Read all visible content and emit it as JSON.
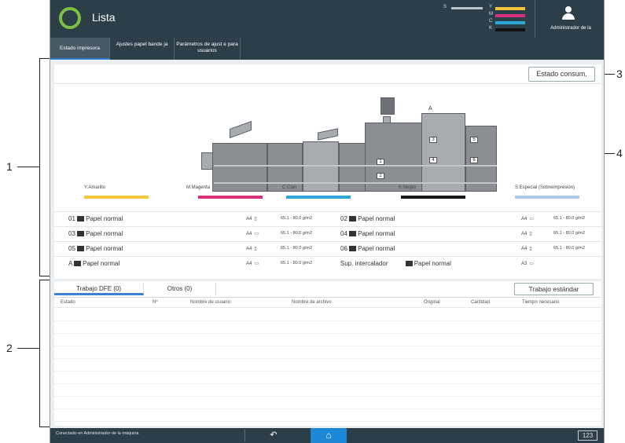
{
  "header": {
    "title": "Lista",
    "toner_labels": [
      "Y",
      "M",
      "C",
      "K"
    ],
    "toner_s_label": "S",
    "user_name": "Administrador de la",
    "colors": {
      "accent_green": "#7dc142",
      "header_bg": "#2c3f49",
      "active_tab": "#2f80d1",
      "home_blue": "#1e88d8"
    }
  },
  "tabs": [
    {
      "label": "Estado impresora",
      "active": true
    },
    {
      "label": "Ajustes papel bande ja",
      "active": false
    },
    {
      "label": "Parámetros de ajust e para usuarios",
      "active": false
    }
  ],
  "panel": {
    "estado_button": "Estado consum."
  },
  "printer_labels": {
    "tray_a": "A",
    "numbers": [
      "1",
      "2",
      "3",
      "4",
      "5",
      "6"
    ]
  },
  "toners": [
    {
      "label": "Y:Amarillo",
      "color": "#f5c63a"
    },
    {
      "label": "M:Magenta",
      "color": "#d9307e"
    },
    {
      "label": "C:Cian",
      "color": "#2da6d8"
    },
    {
      "label": "K:Negro",
      "color": "#1a1a1a"
    },
    {
      "label": "S:Especial (Sobreimpresión)",
      "color": "#a9cbe8"
    }
  ],
  "trays_left": [
    {
      "id": "01",
      "paper": "Papel normal",
      "size": "A4",
      "orient": "portrait",
      "weight": "65.1 - 80.0 g/m2"
    },
    {
      "id": "03",
      "paper": "Papel normal",
      "size": "A4",
      "orient": "landscape",
      "weight": "65.1 - 80.0 g/m2"
    },
    {
      "id": "05",
      "paper": "Papel normal",
      "size": "A4",
      "orient": "portrait",
      "weight": "65.1 - 80.0 g/m2"
    },
    {
      "id": "A",
      "paper": "Papel normal",
      "size": "A4",
      "orient": "landscape",
      "weight": "65.1 - 80.0 g/m2"
    }
  ],
  "trays_right": [
    {
      "id": "02",
      "paper": "Papel normal",
      "size": "A4",
      "orient": "landscape",
      "weight": "65.1 - 80.0 g/m2"
    },
    {
      "id": "04",
      "paper": "Papel normal",
      "size": "A4",
      "orient": "portrait",
      "weight": "65.1 - 80.0 g/m2"
    },
    {
      "id": "06",
      "paper": "Papel normal",
      "size": "A4",
      "orient": "portrait",
      "weight": "65.1 - 80.0 g/m2"
    },
    {
      "id": "Sup. intercalador",
      "paper": "Papel normal",
      "size": "A3",
      "orient": "landscape",
      "weight": ""
    }
  ],
  "jobs": {
    "tab_dfe": "Trabajo DFE (0)",
    "tab_otros": "Otros (0)",
    "standard_button": "Trabajo estándar",
    "columns": [
      "Estado",
      "Nº",
      "Nombre de usuario",
      "Nombre de archivo",
      "Original",
      "Cantidad",
      "Tiempo necesario"
    ],
    "rows": []
  },
  "footer": {
    "status": "Conectado en Administrador de la máquina",
    "back_icon": "↶",
    "home_icon": "⌂",
    "keypad_label": "123"
  },
  "callouts": [
    "1",
    "2",
    "3",
    "4"
  ]
}
